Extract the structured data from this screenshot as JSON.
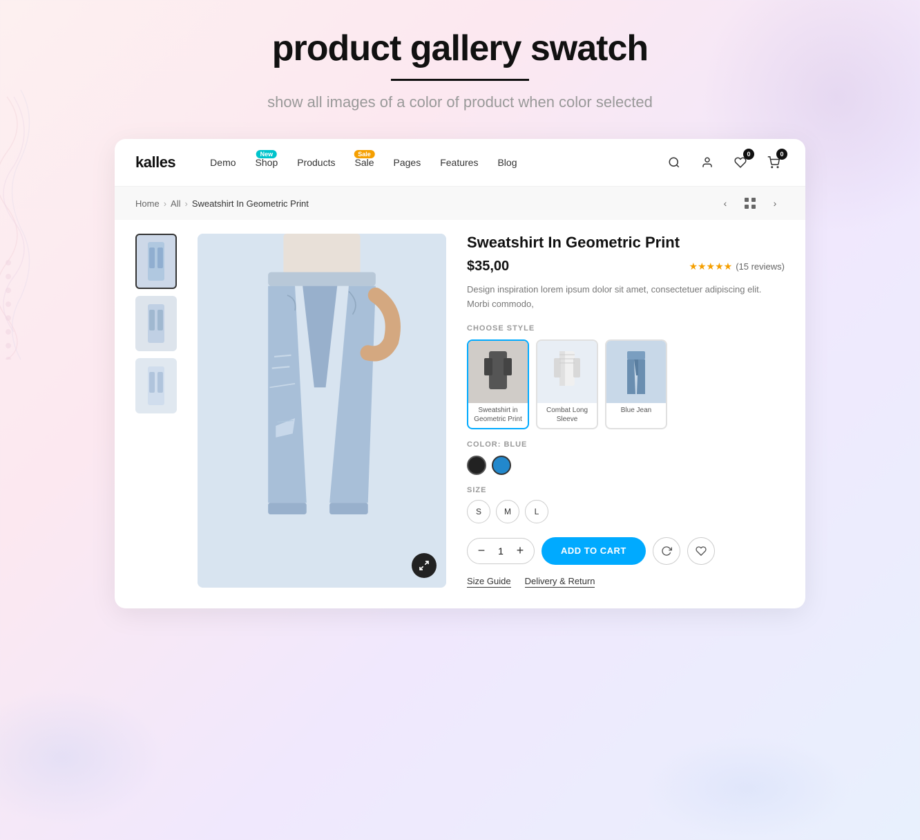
{
  "page": {
    "title": "product gallery swatch",
    "subtitle": "show all images of a color of product when color selected",
    "underline_color": "#111"
  },
  "navbar": {
    "brand": "kalles",
    "links": [
      {
        "label": "Demo",
        "badge": null
      },
      {
        "label": "Shop",
        "badge": {
          "text": "New",
          "type": "new"
        }
      },
      {
        "label": "Products",
        "badge": null
      },
      {
        "label": "Sale",
        "badge": {
          "text": "Sale",
          "type": "sale"
        }
      },
      {
        "label": "Pages",
        "badge": null
      },
      {
        "label": "Features",
        "badge": null
      },
      {
        "label": "Blog",
        "badge": null
      }
    ],
    "cart_count": "0",
    "wishlist_count": "0"
  },
  "breadcrumb": {
    "home": "Home",
    "all": "All",
    "current": "Sweatshirt In Geometric Print"
  },
  "product": {
    "name": "Sweatshirt In Geometric Print",
    "price": "$35,00",
    "rating_stars": "★★★★★",
    "review_count": "(15 reviews)",
    "description": "Design inspiration lorem ipsum dolor sit amet, consectetuer adipiscing elit. Morbi commodo,",
    "choose_style_label": "CHOOSE STYLE",
    "styles": [
      {
        "label": "Sweatshirt in\nGeometric Print",
        "bg": "dark"
      },
      {
        "label": "Combat Long Sleeve",
        "bg": "light"
      },
      {
        "label": "Blue Jean",
        "bg": "denim"
      }
    ],
    "color_label": "COLOR: BLUE",
    "colors": [
      {
        "name": "black",
        "hex": "#222222",
        "selected": false
      },
      {
        "name": "blue",
        "hex": "#2288cc",
        "selected": true
      }
    ],
    "size_label": "SIZE",
    "sizes": [
      "S",
      "M",
      "L"
    ],
    "quantity": "1",
    "add_to_cart_label": "ADD TO CART",
    "size_guide_label": "Size Guide",
    "delivery_label": "Delivery & Return"
  }
}
